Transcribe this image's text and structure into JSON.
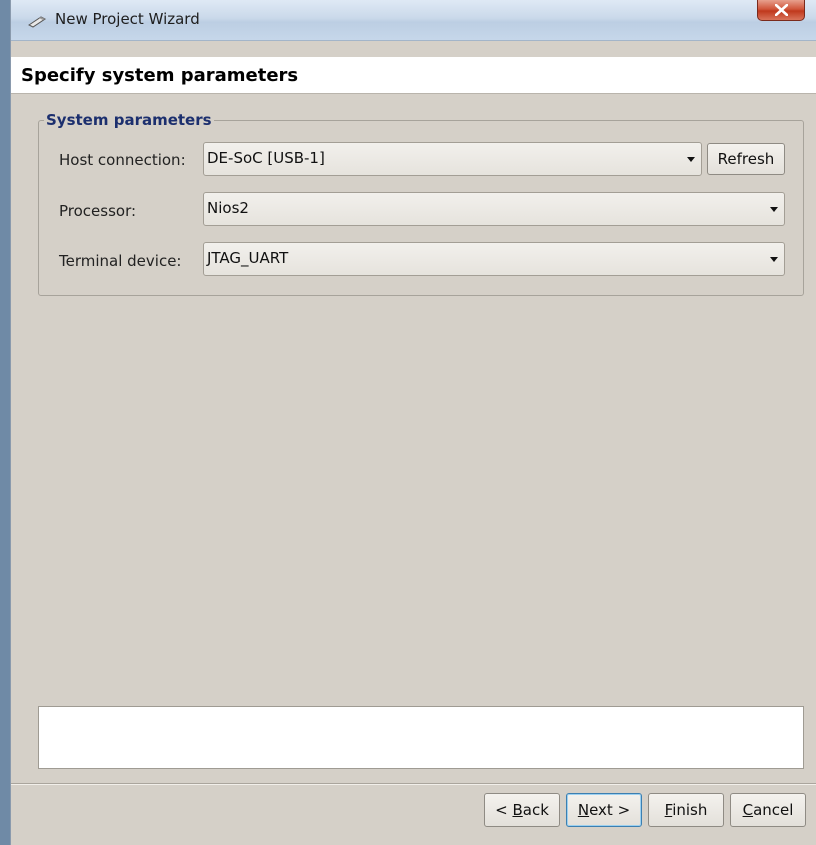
{
  "window": {
    "title": "New Project Wizard",
    "close_symbol": "X"
  },
  "header": {
    "title": "Specify system parameters"
  },
  "group": {
    "legend": "System parameters",
    "host_connection": {
      "label": "Host connection:",
      "value": "DE-SoC [USB-1]",
      "refresh_label": "Refresh"
    },
    "processor": {
      "label": "Processor:",
      "value": "Nios2"
    },
    "terminal_device": {
      "label": "Terminal device:",
      "value": "JTAG_UART"
    }
  },
  "message": {
    "text": ""
  },
  "buttons": {
    "back": {
      "prefix": "< ",
      "mnemonic": "B",
      "rest": "ack"
    },
    "next": {
      "mnemonic": "N",
      "rest": "ext >"
    },
    "finish": {
      "mnemonic": "F",
      "rest": "inish"
    },
    "cancel": {
      "mnemonic": "C",
      "rest": "ancel"
    }
  },
  "icons": {
    "title_icon": "wizard-wand-icon",
    "close_icon": "close-icon",
    "dropdown_icon": "chevron-down-icon"
  },
  "colors": {
    "dialog_bg": "#d5d0c8",
    "legend_text": "#1c2f6e",
    "close_button": "#c0391d",
    "header_bg": "#ffffff"
  }
}
